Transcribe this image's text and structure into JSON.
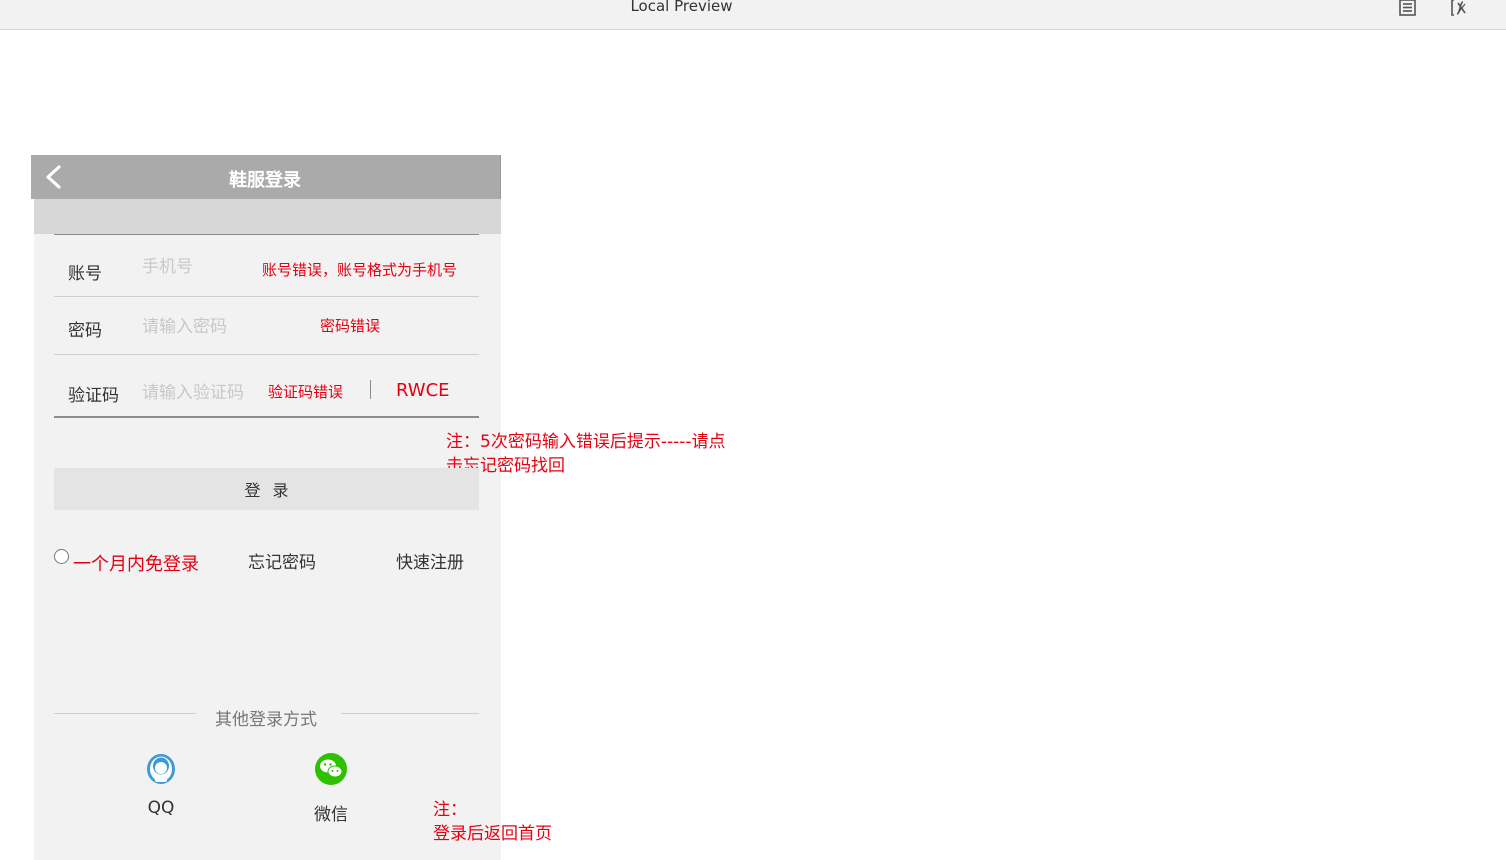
{
  "window": {
    "title": "Local Preview",
    "icons": [
      "document-icon",
      "variable-icon"
    ]
  },
  "header": {
    "title": "鞋服登录",
    "back_icon": "chevron-left-icon"
  },
  "form": {
    "account": {
      "label": "账号",
      "placeholder": "手机号",
      "error": "账号错误，账号格式为手机号"
    },
    "password": {
      "label": "密码",
      "placeholder": "请输入密码",
      "error": "密码错误"
    },
    "captcha": {
      "label": "验证码",
      "placeholder": "请输入验证码",
      "error": "验证码错误",
      "code": "RWCE"
    },
    "login_button": "登录",
    "remember": "一个月内免登录",
    "forgot": "忘记密码",
    "register": "快速注册"
  },
  "notes": {
    "lockout_line1": "注：5次密码输入错误后提示-----请点",
    "lockout_line2": "击忘记密码找回",
    "redirect_line1": "注：",
    "redirect_line2": "登录后返回首页"
  },
  "social": {
    "heading": "其他登录方式",
    "qq": {
      "label": "QQ",
      "icon": "qq-icon"
    },
    "wechat": {
      "label": "微信",
      "icon": "wechat-icon"
    }
  },
  "colors": {
    "error": "#e60012",
    "header_bg": "#aaaaaa",
    "panel_bg": "#f2f2f2",
    "qq_blue": "#3c9bd6",
    "wechat_green": "#2dc100"
  }
}
